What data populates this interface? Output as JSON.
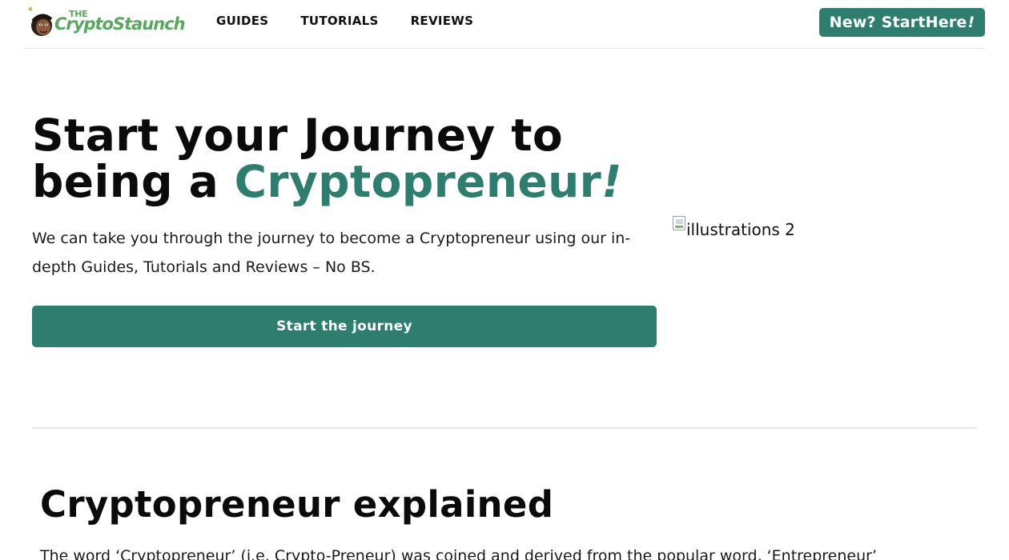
{
  "header": {
    "logo": {
      "the": "THE",
      "name": "CryptoStaunch"
    },
    "nav": [
      {
        "label": "GUIDES"
      },
      {
        "label": "TUTORIALS"
      },
      {
        "label": "REVIEWS"
      }
    ],
    "cta": {
      "label": "New? StartHere",
      "emphasis": "!"
    }
  },
  "hero": {
    "title_line1": "Start your Journey to",
    "title_line2_prefix": "being a ",
    "title_accent": "Cryptopreneur",
    "title_accent_excl": "!",
    "subtitle": "We can take you through the journey to become a Cryptopreneur using our in-depth Guides, Tutorials and Reviews – No BS.",
    "button_label": "Start the journey",
    "illustration_alt": "illustrations 2"
  },
  "section": {
    "title": "Cryptopreneur explained",
    "body": "The word ‘Cryptopreneur’ (i.e. Crypto-Preneur) was coined and derived from the popular word, ‘Entrepreneur’"
  },
  "colors": {
    "accent": "#2e7d6e",
    "logo_green": "#5aa75f",
    "divider": "#e4e6ea"
  },
  "icons": {
    "logo_avatar": "avatar-face-icon",
    "broken_image": "broken-image-icon"
  }
}
